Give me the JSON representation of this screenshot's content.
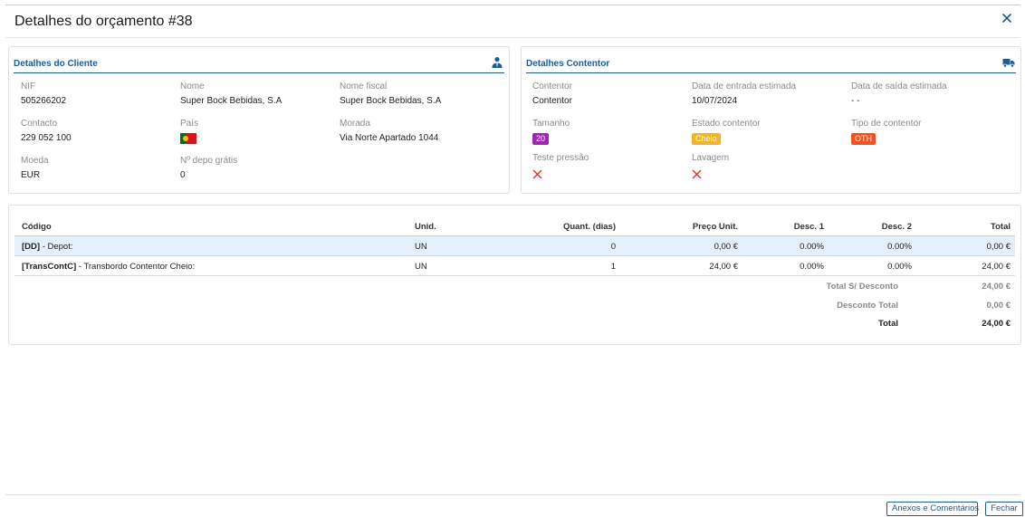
{
  "dialog": {
    "title": "Detalhes do orçamento #38",
    "close_icon": "close-icon"
  },
  "client": {
    "title": "Detalhes do Cliente",
    "icon": "user-tie-icon",
    "nif_label": "NIF",
    "nif": "505266202",
    "name_label": "Nome",
    "name": "Super Bock Bebidas, S.A",
    "fiscal_label": "Nome fiscal",
    "fiscal": "Super Bock Bebidas, S.A",
    "contact_label": "Contacto",
    "contact": "229 052 100",
    "country_label": "País",
    "country_flag": "portugal-flag-icon",
    "address_label": "Morada",
    "address": "Via Norte Apartado 1044",
    "currency_label": "Moeda",
    "currency": "EUR",
    "free_depot_label": "Nº depo grátis",
    "free_depot": "0"
  },
  "container": {
    "title": "Detalhes Contentor",
    "icon": "truck-icon",
    "container_label": "Contentor",
    "container": "Contentor",
    "entry_label": "Data de entrada estimada",
    "entry": "10/07/2024",
    "exit_label": "Data de saída estimada",
    "exit": "- -",
    "size_label": "Tamanho",
    "size": "20",
    "state_label": "Estado contentor",
    "state": "Cheio",
    "type_label": "Tipo de contentor",
    "type": "OTH",
    "pressure_label": "Teste pressão",
    "washing_label": "Lavagem",
    "colors": {
      "size_badge": "#9c27b0",
      "state_badge": "#f1b52a",
      "type_badge": "#f4511e",
      "fail_mark": "#e53935"
    }
  },
  "table": {
    "headers": {
      "code": "Código",
      "unit": "Unid.",
      "qty": "Quant. (dias)",
      "price": "Preço Unit.",
      "disc1": "Desc. 1",
      "disc2": "Desc. 2",
      "total": "Total"
    },
    "rows": [
      {
        "code": "[DD]",
        "desc": " - Depot:",
        "unit": "UN",
        "qty": "0",
        "price": "0,00 €",
        "disc1": "0.00%",
        "disc2": "0.00%",
        "total": "0,00 €"
      },
      {
        "code": "[TransContC]",
        "desc": " - Transbordo Contentor Cheio:",
        "unit": "UN",
        "qty": "1",
        "price": "24,00 €",
        "disc1": "0.00%",
        "disc2": "0.00%",
        "total": "24,00 €"
      }
    ],
    "summary": {
      "no_discount_label": "Total S/ Desconto",
      "no_discount": "24,00 €",
      "discount_label": "Desconto Total",
      "discount": "0,00 €",
      "total_label": "Total",
      "total": "24,00 €"
    }
  },
  "footer": {
    "attachments_button": "Anexos e Comentários",
    "close_button": "Fechar"
  },
  "accent_color": "#1e5b9a"
}
